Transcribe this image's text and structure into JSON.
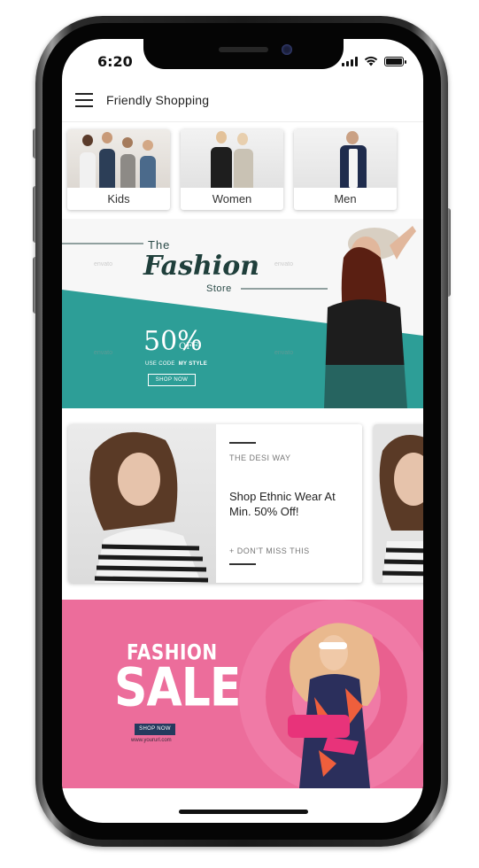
{
  "status_bar": {
    "time": "6:20"
  },
  "app_bar": {
    "title": "Friendly Shopping"
  },
  "categories": [
    {
      "label": "Kids"
    },
    {
      "label": "Women"
    },
    {
      "label": "Men"
    }
  ],
  "banner_fashion_store": {
    "the": "The",
    "fashion": "Fashion",
    "store": "Store",
    "percent": "50%",
    "off": "OFF",
    "code_prefix": "USE CODE",
    "code": "MY STYLE",
    "cta": "SHOP NOW",
    "watermark": "envato",
    "colors": {
      "teal": "#2d9e97",
      "dark_teal": "#1f3f3b"
    }
  },
  "promo_card": {
    "tag": "THE DESI WAY",
    "title": "Shop Ethnic Wear At Min. 50% Off!",
    "cta": "+ DON'T MISS THIS"
  },
  "banner_sale": {
    "fashion": "FASHION",
    "sale": "SALE",
    "cta": "SHOP NOW",
    "url": "www.yoururl.com",
    "colors": {
      "pink": "#ec6d9b",
      "navy": "#243a5e"
    }
  }
}
